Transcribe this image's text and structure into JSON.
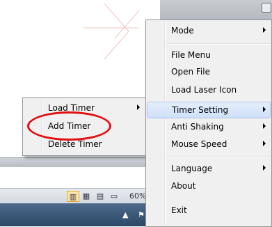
{
  "main_menu": {
    "items": [
      {
        "label": "Mode",
        "submenu": true
      },
      {
        "label": "File Menu",
        "submenu": false
      },
      {
        "label": "Open File",
        "submenu": false
      },
      {
        "label": "Load Laser Icon",
        "submenu": false
      },
      {
        "label": "Timer Setting",
        "submenu": true,
        "highlighted": true
      },
      {
        "label": "Anti Shaking",
        "submenu": true
      },
      {
        "label": "Mouse Speed",
        "submenu": true
      },
      {
        "label": "Language",
        "submenu": true
      },
      {
        "label": "About",
        "submenu": false
      },
      {
        "label": "Exit",
        "submenu": false
      }
    ]
  },
  "timer_submenu": {
    "items": [
      {
        "label": "Load Timer",
        "submenu": true
      },
      {
        "label": "Add Timer",
        "submenu": false,
        "circled": true
      },
      {
        "label": "Delete Timer",
        "submenu": false
      }
    ]
  },
  "status_bar": {
    "zoom": "60%"
  },
  "colors": {
    "highlight_fill": "#cfe0f8",
    "annotation_red": "#e01010",
    "menu_bg": "#f0f0f0"
  }
}
